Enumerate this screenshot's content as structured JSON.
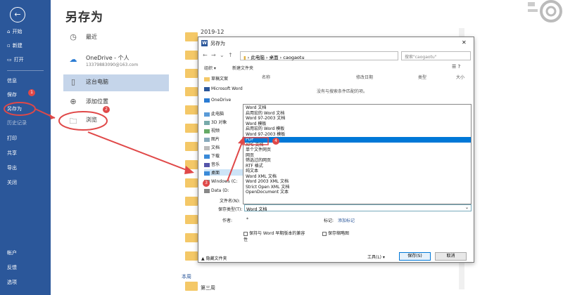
{
  "backstage": {
    "title": "另存为",
    "nav": [
      {
        "label": "开始",
        "icon": "home-icon"
      },
      {
        "label": "新建",
        "icon": "new-doc-icon"
      },
      {
        "label": "打开",
        "icon": "folder-open-icon"
      },
      {
        "label": "信息",
        "icon": ""
      },
      {
        "label": "保存",
        "icon": ""
      },
      {
        "label": "另存为",
        "icon": ""
      },
      {
        "label": "历史记录",
        "icon": ""
      },
      {
        "label": "打印",
        "icon": ""
      },
      {
        "label": "共享",
        "icon": ""
      },
      {
        "label": "导出",
        "icon": ""
      },
      {
        "label": "关闭",
        "icon": ""
      },
      {
        "label": "帐户",
        "icon": ""
      },
      {
        "label": "反馈",
        "icon": ""
      },
      {
        "label": "选项",
        "icon": ""
      }
    ],
    "locations": [
      {
        "label": "最近",
        "icon": "clock-icon"
      },
      {
        "label": "OneDrive - 个人",
        "sub": "13379883090@163.com",
        "icon": "cloud-icon"
      },
      {
        "label": "这台电脑",
        "icon": "computer-icon"
      },
      {
        "label": "添加位置",
        "icon": "globe-icon"
      },
      {
        "label": "浏览",
        "icon": "folder-icon"
      }
    ],
    "recent_group": "2019-12",
    "week_label": "本周",
    "bottom_item": "第三周"
  },
  "annotations": {
    "badges": [
      "1",
      "2",
      "3",
      "4"
    ],
    "color": "#e04848"
  },
  "dialog": {
    "title": "另存为",
    "path": [
      "此电脑",
      "桌面",
      "caogaotu"
    ],
    "search_placeholder": "搜索\"caogaotu\"",
    "toolbar": {
      "organize": "组织 ▾",
      "new_folder": "新建文件夹"
    },
    "tree": [
      "草稿文案",
      "Microsoft Word",
      "OneDrive",
      "此电脑",
      "3D 对象",
      "视频",
      "图片",
      "文档",
      "下载",
      "音乐",
      "桌面",
      "Windows (C:",
      "Data (D:"
    ],
    "columns": {
      "name": "名称",
      "modified": "修改日期",
      "type": "类型",
      "size": "大小"
    },
    "empty_text": "没有与搜索条件匹配的项。",
    "filetypes": [
      "Word 文档",
      "启用宏的 Word 文档",
      "Word 97-2003 文档",
      "Word 模板",
      "启用宏的 Word 模板",
      "Word 97-2003 模板",
      "PDF",
      "XPS 文档",
      "单个文件网页",
      "网页",
      "筛选过的网页",
      "RTF 格式",
      "纯文本",
      "Word XML 文档",
      "Word 2003 XML 文档",
      "Strict Open XML 文档",
      "OpenDocument 文本"
    ],
    "selected_type_index": 6,
    "filename_label": "文件名(N):",
    "type_label": "保存类型(T):",
    "type_value": "Word 文档",
    "author_label": "作者:",
    "author_value": "*",
    "tags_label": "标记:",
    "tags_value": "添加标记",
    "compat_label": "保持与 Word 早期版本的兼容性",
    "thumb_label": "保存缩略图",
    "hide_folders": "▲ 隐藏文件夹",
    "tools_button": "工具(L) ▾",
    "save_button": "保存(S)",
    "cancel_button": "取消"
  }
}
